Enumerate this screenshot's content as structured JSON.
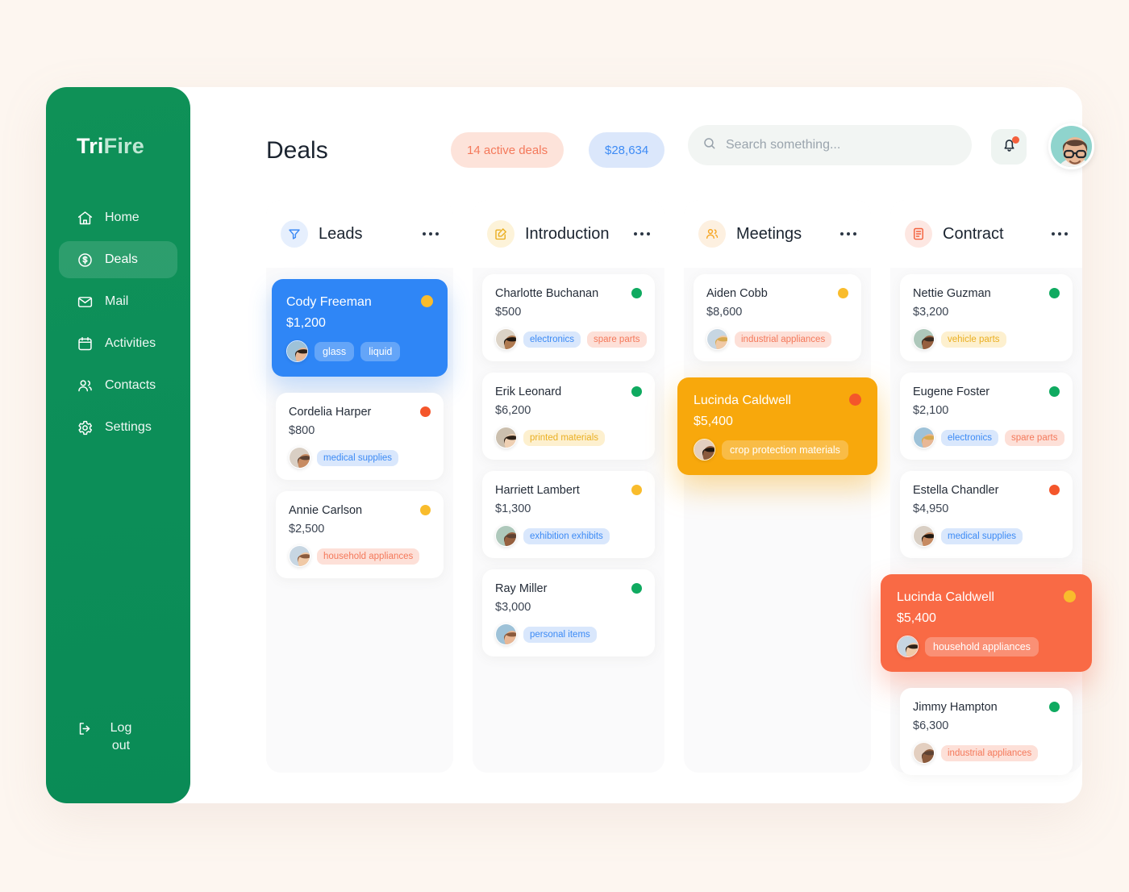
{
  "sidebar": {
    "brand_primary": "Tri",
    "brand_secondary": "Fire",
    "items": [
      {
        "label": "Home",
        "icon": "home-icon",
        "active": false
      },
      {
        "label": "Deals",
        "icon": "dollar-icon",
        "active": true
      },
      {
        "label": "Mail",
        "icon": "envelope-icon",
        "active": false
      },
      {
        "label": "Activities",
        "icon": "calendar-icon",
        "active": false
      },
      {
        "label": "Contacts",
        "icon": "people-icon",
        "active": false
      },
      {
        "label": "Settings",
        "icon": "gear-icon",
        "active": false
      }
    ],
    "logout_label": "Log out",
    "accent": "#0d8f59"
  },
  "header": {
    "title": "Deals",
    "badge_deals": "14 active deals",
    "badge_amount": "$28,634",
    "badge_deals_color": "#f4795b",
    "badge_amount_color": "#3d8bf5"
  },
  "search": {
    "placeholder": "Search something...",
    "value": ""
  },
  "board": {
    "columns": [
      {
        "title": "Leads",
        "icon": "funnel-icon",
        "icon_color": "#3d8bf5",
        "menu": "more-options",
        "cards": [
          {
            "name": "Cody Freeman",
            "amount": "$1,200",
            "status": "yellow",
            "highlight": "blue",
            "tags": [
              {
                "label": "glass",
                "color": "white"
              },
              {
                "label": "liquid",
                "color": "white"
              }
            ]
          },
          {
            "name": "Cordelia Harper",
            "amount": "$800",
            "status": "red",
            "highlight": "none",
            "tags": [
              {
                "label": "medical supplies",
                "color": "blue"
              }
            ]
          },
          {
            "name": "Annie Carlson",
            "amount": "$2,500",
            "status": "yellow",
            "highlight": "none",
            "tags": [
              {
                "label": "household appliances",
                "color": "coral"
              }
            ]
          }
        ]
      },
      {
        "title": "Introduction",
        "icon": "edit-square-icon",
        "icon_color": "#eaaf22",
        "menu": "more-options",
        "cards": [
          {
            "name": "Charlotte Buchanan",
            "amount": "$500",
            "status": "green",
            "highlight": "none",
            "tags": [
              {
                "label": "electronics",
                "color": "blue"
              },
              {
                "label": "spare parts",
                "color": "coral"
              }
            ]
          },
          {
            "name": "Erik Leonard",
            "amount": "$6,200",
            "status": "green",
            "highlight": "none",
            "tags": [
              {
                "label": "printed materials",
                "color": "yellow"
              }
            ]
          },
          {
            "name": "Harriett Lambert",
            "amount": "$1,300",
            "status": "yellow",
            "highlight": "none",
            "tags": [
              {
                "label": "exhibition exhibits",
                "color": "blue"
              }
            ]
          },
          {
            "name": "Ray Miller",
            "amount": "$3,000",
            "status": "green",
            "highlight": "none",
            "tags": [
              {
                "label": "personal items",
                "color": "blue"
              }
            ]
          }
        ]
      },
      {
        "title": "Meetings",
        "icon": "people-icon",
        "icon_color": "#f6a623",
        "menu": "more-options",
        "cards": [
          {
            "name": "Aiden Cobb",
            "amount": "$8,600",
            "status": "yellow",
            "highlight": "none",
            "tags": [
              {
                "label": "industrial appliances",
                "color": "coral"
              }
            ]
          },
          {
            "name": "Lucinda Caldwell",
            "amount": "$5,400",
            "status": "red",
            "highlight": "orange",
            "tags": [
              {
                "label": "crop protection materials",
                "color": "white"
              }
            ]
          }
        ]
      },
      {
        "title": "Contract",
        "icon": "document-icon",
        "icon_color": "#f4603c",
        "menu": "more-options",
        "cards": [
          {
            "name": "Nettie Guzman",
            "amount": "$3,200",
            "status": "green",
            "highlight": "none",
            "tags": [
              {
                "label": "vehicle parts",
                "color": "yellow"
              }
            ]
          },
          {
            "name": "Eugene Foster",
            "amount": "$2,100",
            "status": "green",
            "highlight": "none",
            "tags": [
              {
                "label": "electronics",
                "color": "blue"
              },
              {
                "label": "spare parts",
                "color": "coral"
              }
            ]
          },
          {
            "name": "Estella Chandler",
            "amount": "$4,950",
            "status": "red",
            "highlight": "none",
            "tags": [
              {
                "label": "medical supplies",
                "color": "blue"
              }
            ]
          },
          {
            "name": "Lucinda Caldwell",
            "amount": "$5,400",
            "status": "yellow",
            "highlight": "coral",
            "tags": [
              {
                "label": "household appliances",
                "color": "white"
              }
            ]
          },
          {
            "name": "Jimmy Hampton",
            "amount": "$6,300",
            "status": "green",
            "highlight": "none",
            "tags": [
              {
                "label": "industrial appliances",
                "color": "coral"
              }
            ]
          }
        ]
      }
    ]
  }
}
